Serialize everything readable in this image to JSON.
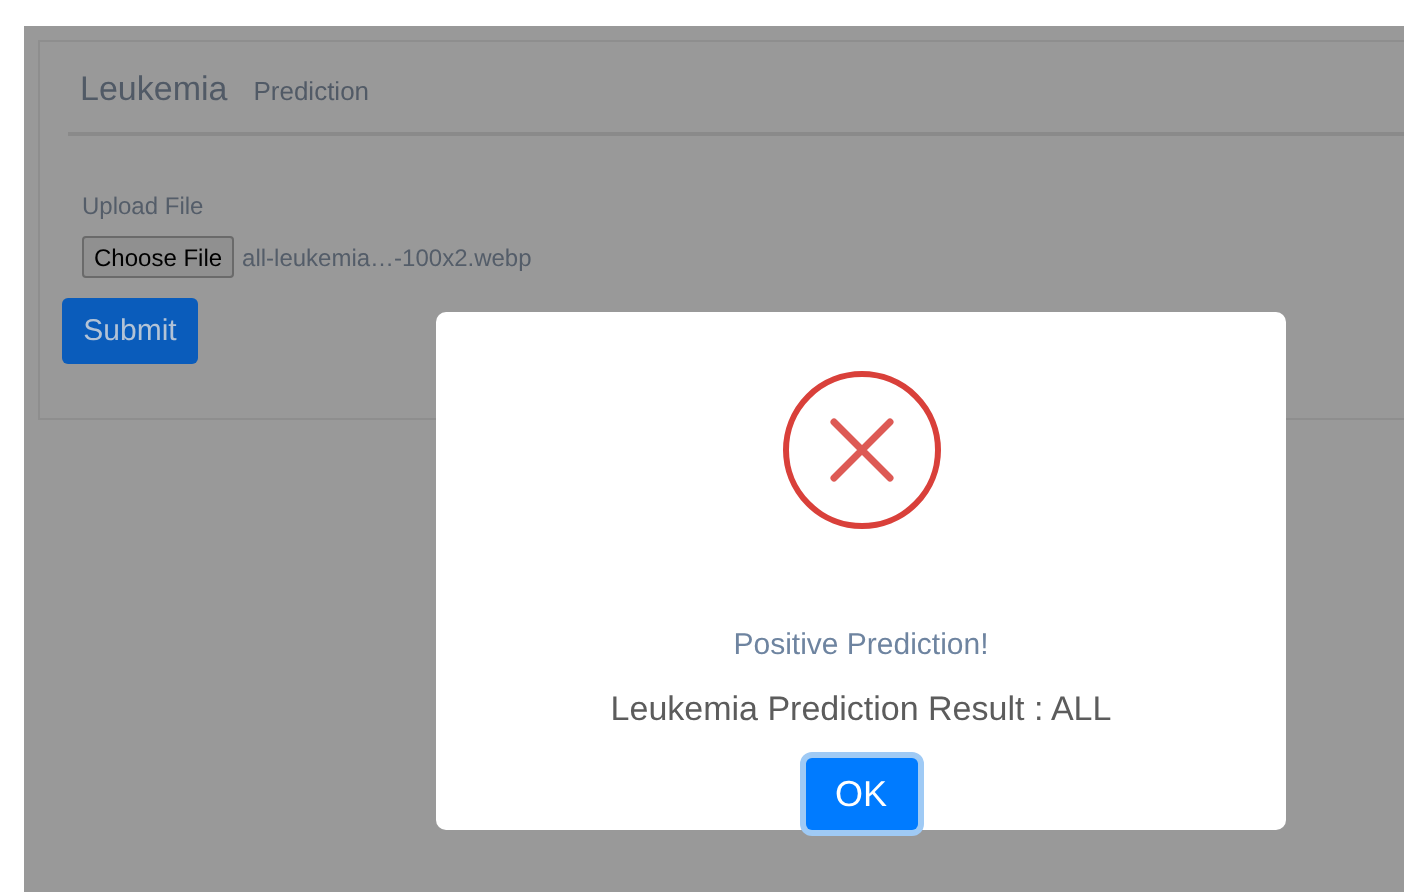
{
  "header": {
    "brand": "Leukemia",
    "subtitle": "Prediction"
  },
  "form": {
    "label": "Upload File",
    "choose_button": "Choose File",
    "file_name": "all-leukemia…-100x2.webp",
    "submit": "Submit"
  },
  "dialog": {
    "icon": {
      "kind": "error"
    },
    "title": "Positive Prediction!",
    "message": "Leukemia Prediction Result : ALL",
    "button": "OK"
  }
}
